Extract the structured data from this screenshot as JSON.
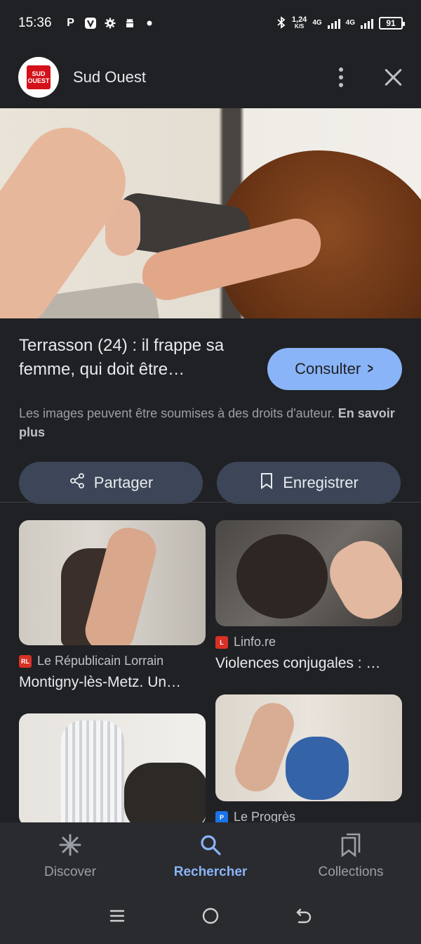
{
  "status_bar": {
    "time": "15:36",
    "speed_value": "1,24",
    "speed_unit": "K/S",
    "net1": "4G",
    "net2": "4G",
    "battery": "91"
  },
  "header": {
    "logo_line1": "SUD",
    "logo_line2": "OUEST",
    "source_name": "Sud Ouest"
  },
  "result": {
    "title": "Terrasson (24) : il frappe sa femme, qui doit être…",
    "consult_label": "Consulter",
    "copyright_text": "Les images peuvent être soumises à des droits d'auteur.",
    "learn_more": "En savoir plus",
    "share_label": "Partager",
    "save_label": "Enregistrer"
  },
  "related": [
    {
      "source": "Le Républicain Lorrain",
      "favicon_text": "RL",
      "favicon_color": "#d93025",
      "title": "Montigny-lès-Metz. Un…"
    },
    {
      "source": "Linfo.re",
      "favicon_text": "L",
      "favicon_color": "#d93025",
      "title": "Violences conjugales : …"
    },
    {
      "source": "",
      "favicon_text": "",
      "favicon_color": "",
      "title": ""
    },
    {
      "source": "Le Progrès",
      "favicon_text": "P",
      "favicon_color": "#1a73e8",
      "title": ""
    }
  ],
  "bottom_nav": {
    "discover": "Discover",
    "search": "Rechercher",
    "collections": "Collections"
  },
  "colors": {
    "background": "#202124",
    "accent": "#8ab4f8",
    "pill": "#3c4658"
  }
}
